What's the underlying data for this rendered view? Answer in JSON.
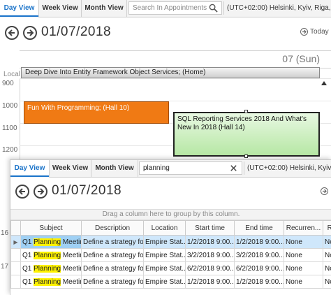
{
  "back": {
    "tabs": [
      "Day View",
      "Week View",
      "Month View"
    ],
    "search_placeholder": "Search In Appointments",
    "timezone": "(UTC+02:00) Helsinki, Kyiv, Riga,",
    "date": "01/07/2018",
    "today_label": "Today",
    "day_header": "07 (Sun)",
    "local_label": "Local",
    "all_day_appointment": "Deep Dive Into Entity Framework Object Services; (Home)",
    "time_labels": [
      "900",
      "1000",
      "1100",
      "1200"
    ],
    "appointments": [
      {
        "text": "Fun With Programming; (Hall 10)",
        "color": "#f07a14"
      },
      {
        "text": "SQL Reporting Services 2018 And What's New In 2018 (Hall 14)",
        "color": "#b6e7a4"
      }
    ]
  },
  "front": {
    "tabs": [
      "Day View",
      "Week View",
      "Month View"
    ],
    "search_value": "planning",
    "timezone": "(UTC+02:00) Helsinki, Kyiv, Riga,",
    "date": "01/07/2018",
    "group_hint": "Drag a column here to group by this column.",
    "left_row_numbers": [
      "16",
      "17"
    ],
    "columns": [
      "Subject",
      "Description",
      "Location",
      "Start time",
      "End time",
      "Recurren...",
      "Re"
    ],
    "rows": [
      {
        "subject_pre": "Q1 ",
        "subject_hl": "Planning",
        "subject_post": " Meeting",
        "description": "Define a strategy fo...",
        "location": "Empire Stat...",
        "start": "1/2/2018 9:00...",
        "end": "1/2/2018 9:00...",
        "recurrence": "None",
        "re": "None"
      },
      {
        "subject_pre": "Q1 ",
        "subject_hl": "Planning",
        "subject_post": " Meeting",
        "description": "Define a strategy fo...",
        "location": "Empire Stat...",
        "start": "3/2/2018 9:00...",
        "end": "3/2/2018 9:00...",
        "recurrence": "None",
        "re": "None"
      },
      {
        "subject_pre": "Q1 ",
        "subject_hl": "Planning",
        "subject_post": " Meeting",
        "description": "Define a strategy fo...",
        "location": "Empire Stat...",
        "start": "6/2/2018 9:00...",
        "end": "6/2/2018 9:00...",
        "recurrence": "None",
        "re": "None"
      },
      {
        "subject_pre": "Q1 ",
        "subject_hl": "Planning",
        "subject_post": " Meeting",
        "description": "Define a strategy fo...",
        "location": "Empire Stat...",
        "start": "1/2/2018 9:00...",
        "end": "1/2/2018 9:00...",
        "recurrence": "None",
        "re": "None"
      }
    ],
    "accent_color": "#1a73c9",
    "highlight_color": "#fff200"
  }
}
